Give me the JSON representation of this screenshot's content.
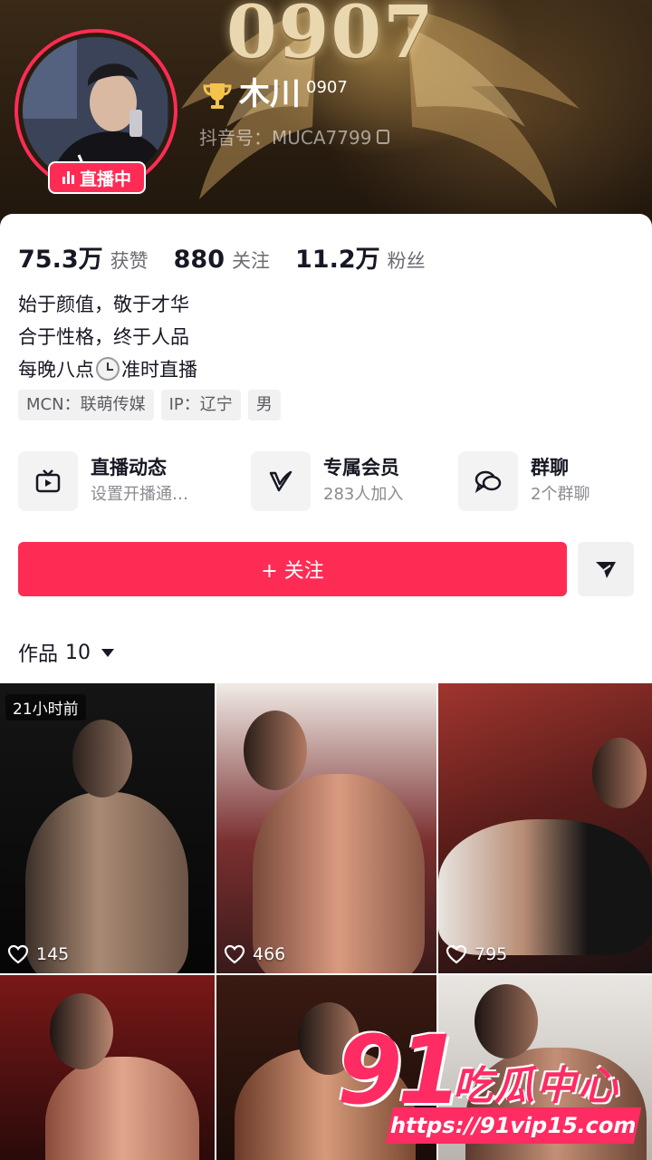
{
  "header": {
    "banner_number": "0907",
    "live_badge": "直播中",
    "nickname": "木川",
    "nickname_suffix": "0907",
    "douyin_id": "抖音号：MUCA7799"
  },
  "stats": [
    {
      "num": "75.3万",
      "label": "获赞"
    },
    {
      "num": "880",
      "label": "关注"
    },
    {
      "num": "11.2万",
      "label": "粉丝"
    }
  ],
  "bio": {
    "line1": "始于颜值，敬于才华",
    "line2": "合于性格，终于人品",
    "line3_before": "每晚八点",
    "line3_after": "准时直播"
  },
  "tags": [
    "MCN：联萌传媒",
    "IP：辽宁",
    "男"
  ],
  "features": [
    {
      "title": "直播动态",
      "sub": "设置开播通…",
      "icon": "tv-icon"
    },
    {
      "title": "专属会员",
      "sub": "283人加入",
      "icon": "vip-v-icon"
    },
    {
      "title": "群聊",
      "sub": "2个群聊",
      "icon": "chat-bubbles-icon"
    }
  ],
  "follow_button": "+ 关注",
  "works_tab": {
    "label": "作品",
    "count": "10"
  },
  "videos": [
    {
      "likes": "145",
      "time": "21小时前"
    },
    {
      "likes": "466"
    },
    {
      "likes": "795"
    },
    {},
    {},
    {}
  ],
  "watermark": {
    "big": "91",
    "text": "吃瓜中心",
    "url": "https://91vip15.com"
  },
  "colors": {
    "accent": "#fe2c55",
    "banner": "#2a1d10"
  }
}
